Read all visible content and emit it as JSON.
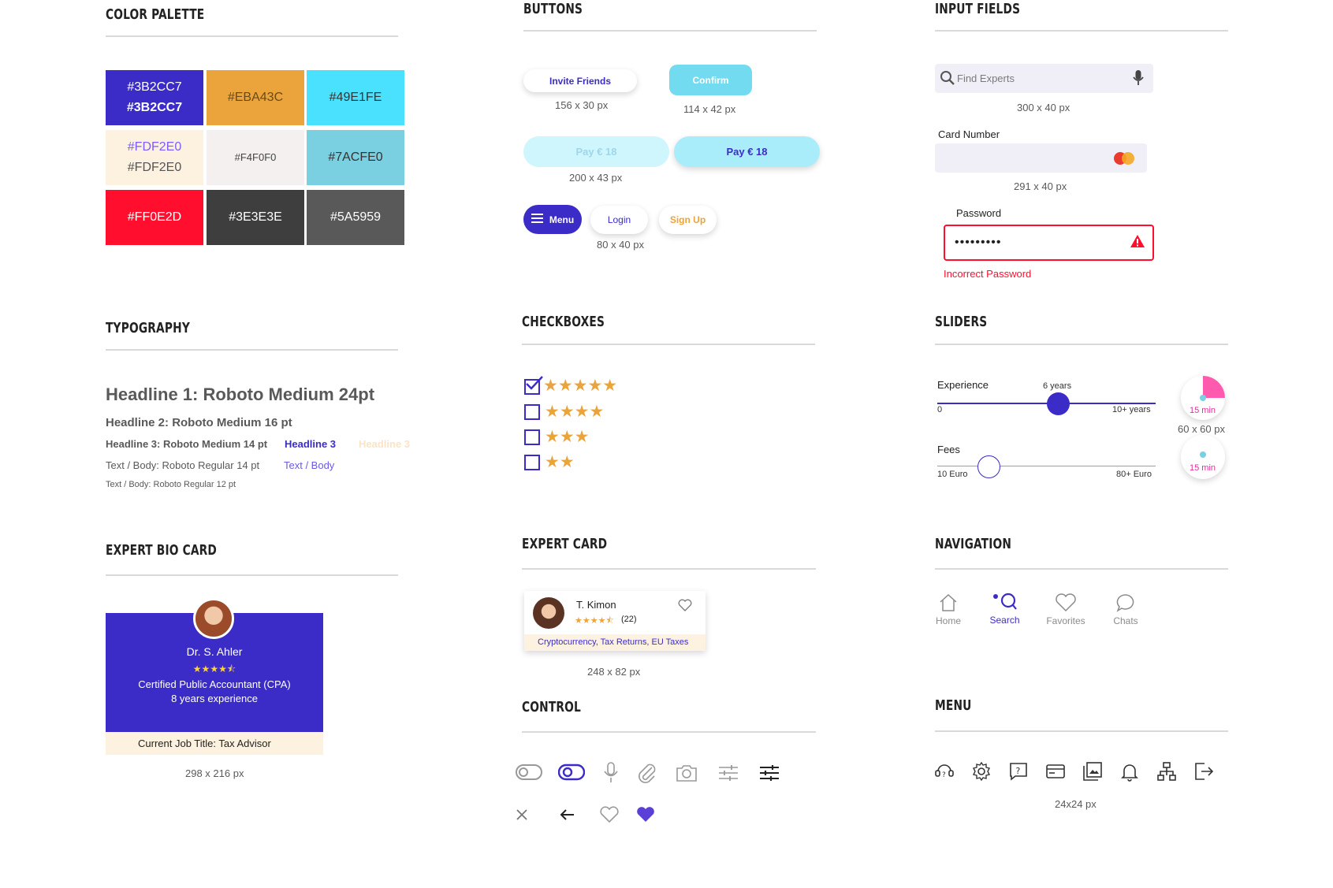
{
  "sections": {
    "color_palette": "COLOR PALETTE",
    "buttons": "BUTTONS",
    "input_fields": "INPUT FIELDS",
    "typography": "TYPOGRAPHY",
    "checkboxes": "CHECKBOXES",
    "sliders": "SLIDERS",
    "expert_bio_card": "EXPERT BIO CARD",
    "expert_card": "EXPERT CARD",
    "navigation": "NAVIGATION",
    "control": "CONTROL",
    "menu": "MENU"
  },
  "palette": {
    "c1_a": "#3B2CC7",
    "c1_b": "#3B2CC7",
    "c2": "#EBA43C",
    "c3": "#49E1FE",
    "c4_a": "#FDF2E0",
    "c4_b": "#FDF2E0",
    "c5": "#F4F0F0",
    "c6": "#7ACFE0",
    "c7": "#FF0E2D",
    "c8": "#3E3E3E",
    "c9": "#5A5959"
  },
  "buttons": {
    "invite": "Invite Friends",
    "invite_dim": "156 x 30 px",
    "confirm": "Confirm",
    "confirm_dim": "114 x 42  px",
    "pay_disabled": "Pay € 18",
    "pay_active": "Pay € 18",
    "pay_dim": "200 x 43  px",
    "menu": "Menu",
    "login": "Login",
    "signup": "Sign Up",
    "small_dim": "80 x 40 px"
  },
  "inputs": {
    "search_placeholder": "Find Experts",
    "search_dim": "300 x 40  px",
    "card_label": "Card Number",
    "card_dim": "291 x 40  px",
    "password_label": "Password",
    "password_value": "•••••••••",
    "password_error": "Incorrect Password"
  },
  "typography": {
    "h1": "Headline 1: Roboto Medium 24pt",
    "h2": "Headline 2:  Roboto Medium 16 pt",
    "h3": "Headline 3: Roboto Medium 14 pt",
    "h3_purple": "Headline 3",
    "h3_light": "Headline 3",
    "body14": "Text / Body: Roboto Regular 14 pt",
    "body_purple": "Text / Body",
    "body12": "Text / Body:  Roboto Regular 12 pt"
  },
  "checkboxes": [
    {
      "stars": "★★★★★",
      "checked": true
    },
    {
      "stars": "★★★★",
      "checked": false
    },
    {
      "stars": "★★★",
      "checked": false
    },
    {
      "stars": "★★",
      "checked": false
    }
  ],
  "sliders": {
    "experience_label": "Experience",
    "experience_value": "6 years",
    "experience_min": "0",
    "experience_max": "10+ years",
    "experience_level": 0.6,
    "fees_label": "Fees",
    "fees_min": "10 Euro",
    "fees_max": "80+ Euro",
    "fees_level": 0.2,
    "timer1": "15 min",
    "timer2": "15 min",
    "timer_dim": "60 x 60  px"
  },
  "bio_card": {
    "name": "Dr. S. Ahler",
    "rating": "★★★★⯪",
    "title": "Certified Public Accountant (CPA)",
    "experience": "8 years experience",
    "job": "Current Job Title: Tax Advisor",
    "dim": "298 x 216 px"
  },
  "expert_card": {
    "name": "T. Kimon",
    "rating": "★★★★⯪",
    "reviews": "(22)",
    "tags": "Cryptocurrency,  Tax Returns,  EU Taxes",
    "dim": "248 x 82  px"
  },
  "navigation": {
    "home": "Home",
    "search": "Search",
    "favorites": "Favorites",
    "chats": "Chats"
  },
  "menu": {
    "dim": "24x24 px"
  },
  "colors": {
    "primary": "#3B2CC7",
    "accent": "#EBA43C",
    "cyan": "#49E1FE",
    "error": "#FF0E2D"
  }
}
